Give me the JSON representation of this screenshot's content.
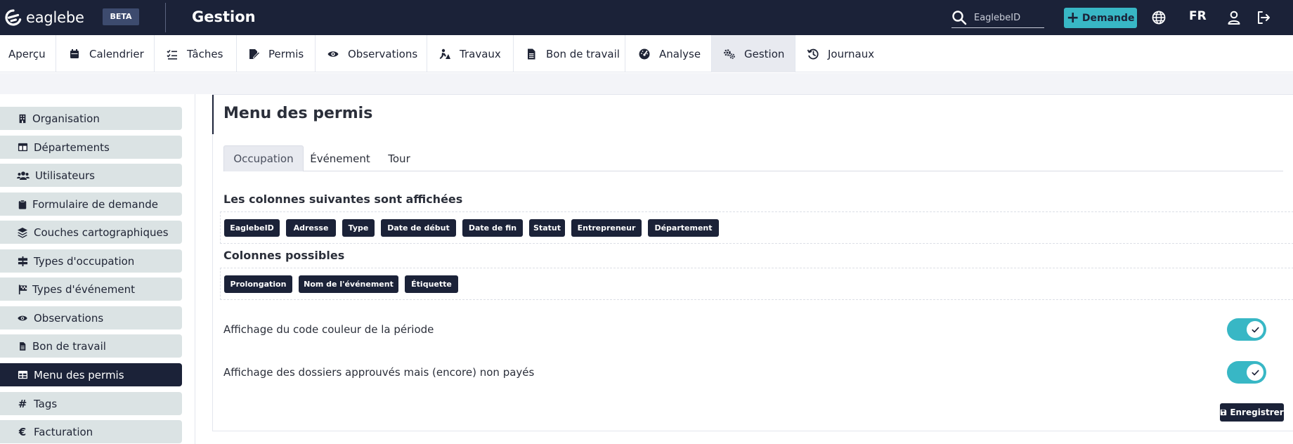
{
  "topbar": {
    "logo_text": "eaglebe",
    "beta_label": "BETA",
    "app_title": "Gestion",
    "search_placeholder": "EaglebeID",
    "demande_label": "Demande",
    "language": "FR",
    "icons": [
      "search-icon",
      "plus-icon",
      "globe-icon",
      "user-icon",
      "logout-icon"
    ]
  },
  "tabs": [
    {
      "label": "Aperçu",
      "icon": "none"
    },
    {
      "label": "Calendrier",
      "icon": "calendar-icon"
    },
    {
      "label": "Tâches",
      "icon": "tasks-icon"
    },
    {
      "label": "Permis",
      "icon": "permit-icon"
    },
    {
      "label": "Observations",
      "icon": "eye-icon"
    },
    {
      "label": "Travaux",
      "icon": "worker-icon"
    },
    {
      "label": "Bon de travail",
      "icon": "file-icon"
    },
    {
      "label": "Analyse",
      "icon": "gauge-icon"
    },
    {
      "label": "Gestion",
      "icon": "gears-icon",
      "active": true
    },
    {
      "label": "Journaux",
      "icon": "history-icon"
    }
  ],
  "sidebar": {
    "items": [
      {
        "label": "Organisation",
        "icon": "building-icon"
      },
      {
        "label": "Départements",
        "icon": "table-icon"
      },
      {
        "label": "Utilisateurs",
        "icon": "users-icon"
      },
      {
        "label": "Formulaire de demande",
        "icon": "clipboard-icon"
      },
      {
        "label": "Couches cartographiques",
        "icon": "layers-icon"
      },
      {
        "label": "Types d'occupation",
        "icon": "sign-icon"
      },
      {
        "label": "Types d'événement",
        "icon": "flag-icon"
      },
      {
        "label": "Observations",
        "icon": "eye-icon"
      },
      {
        "label": "Bon de travail",
        "icon": "file-icon"
      },
      {
        "label": "Menu des permis",
        "icon": "table-icon",
        "active": true
      },
      {
        "label": "Tags",
        "icon": "hash-icon",
        "glyph": "#"
      },
      {
        "label": "Facturation",
        "icon": "euro-icon",
        "glyph": "€"
      }
    ]
  },
  "main": {
    "title": "Menu des permis",
    "subtabs": [
      {
        "label": "Occupation",
        "active": true
      },
      {
        "label": "Événement"
      },
      {
        "label": "Tour"
      }
    ],
    "shown_title": "Les colonnes suivantes sont affichées",
    "shown_columns": [
      "EaglebeID",
      "Adresse",
      "Type",
      "Date de début",
      "Date de fin",
      "Statut",
      "Entrepreneur",
      "Département"
    ],
    "possible_title": "Colonnes possibles",
    "possible_columns": [
      "Prolongation",
      "Nom de l'événement",
      "Étiquette"
    ],
    "settings": [
      {
        "label": "Affichage du code couleur de la période",
        "enabled": true
      },
      {
        "label": "Affichage des dossiers approuvés mais (encore) non payés",
        "enabled": true
      }
    ],
    "save_label": "Enregistrer"
  },
  "colors": {
    "navy": "#1b2238",
    "accent": "#38b7c5",
    "sidebar_item": "#dbe3e4"
  }
}
